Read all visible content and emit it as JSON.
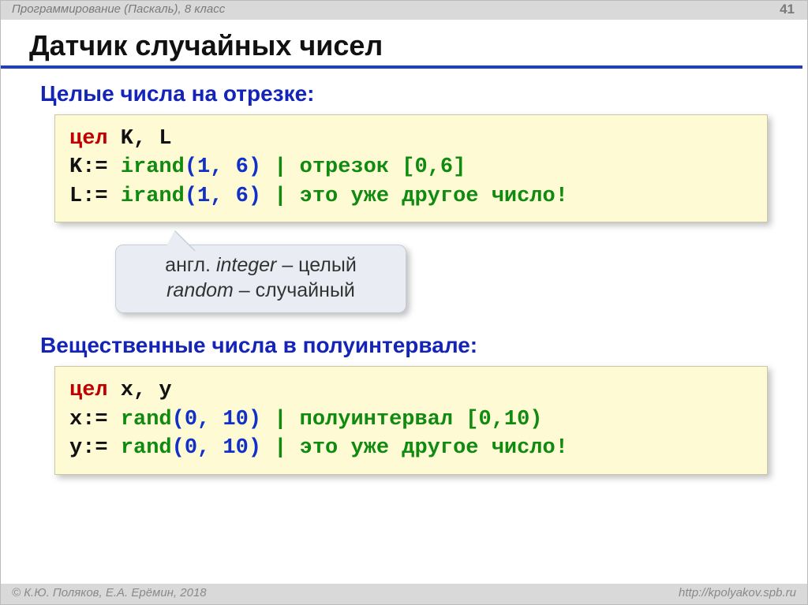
{
  "header": {
    "breadcrumb": "Программирование (Паскаль), 8 класс",
    "page": "41"
  },
  "title": "Датчик случайных чисел",
  "section1": {
    "heading": "Целые числа на отрезке:",
    "code": {
      "kw": "цел",
      "vars": " K, L",
      "l2a": "K:=",
      "l2fn": "irand",
      "l2args": "(1, 6)",
      "l2c": " | отрезок [0,6]",
      "l3a": "L:=",
      "l3fn": "irand",
      "l3args": "(1, 6)",
      "l3c": " | это уже другое число!"
    }
  },
  "callout": {
    "l1a": "англ. ",
    "l1b": "integer",
    "l1c": " – целый",
    "l2a": "random",
    "l2b": " – случайный"
  },
  "section2": {
    "heading": "Вещественные числа в полуинтервале:",
    "code": {
      "kw": "цел",
      "vars": " x, y",
      "l2a": "x:=",
      "l2fn": "rand",
      "l2args": "(0, 10)",
      "l2c": " | полуинтервал [0,10)",
      "l3a": "y:=",
      "l3fn": "rand",
      "l3args": "(0, 10)",
      "l3c": " | это уже другое число!"
    }
  },
  "footer": {
    "left": "© К.Ю. Поляков, Е.А. Ерёмин, 2018",
    "right": "http://kpolyakov.spb.ru"
  }
}
